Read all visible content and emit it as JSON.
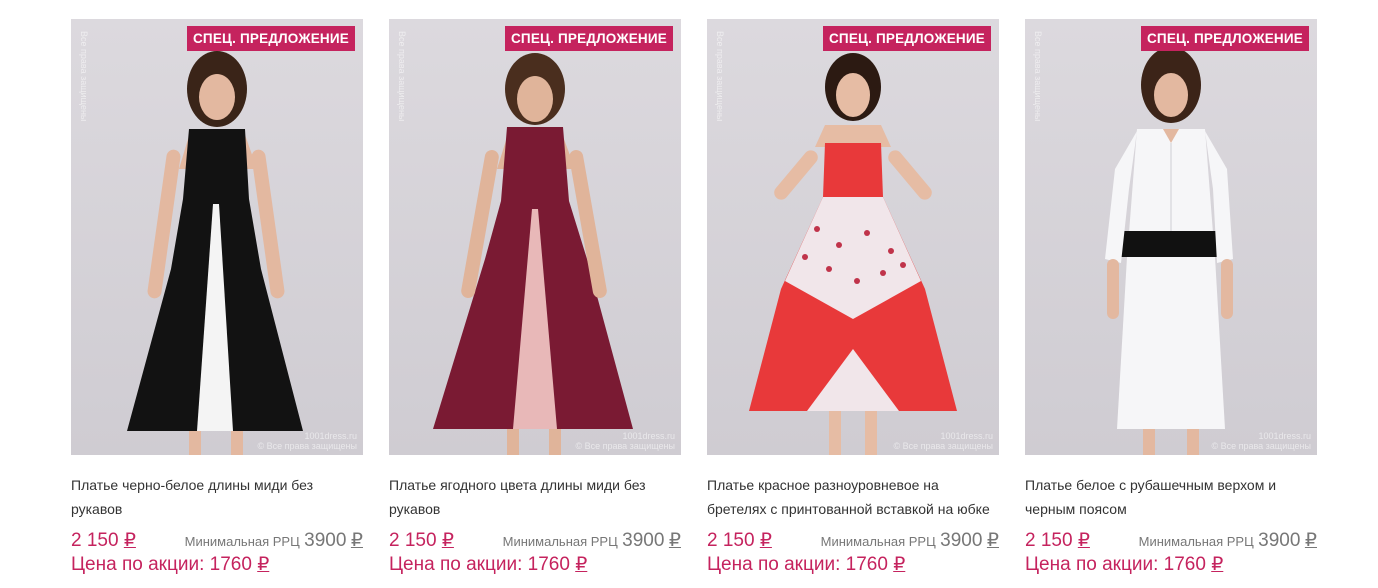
{
  "watermark": {
    "side": "Все права защищены",
    "site": "1001dress.ru",
    "bottom_line1": "1001dress.ru",
    "bottom_line2": "© Все права защищены"
  },
  "colors": {
    "accent": "#c5235e",
    "muted": "#777777"
  },
  "products": [
    {
      "badge": "Спец. предложение",
      "name": "Платье черно-белое длины миди без рукавов",
      "price": "2 150",
      "currency": "₽",
      "rrp_label": "Минимальная РРЦ",
      "rrp_value": "3900",
      "promo": "Цена по акции: 1760",
      "dress": "black-white"
    },
    {
      "badge": "Спец. предложение",
      "name": "Платье ягодного цвета длины миди без рукавов",
      "price": "2 150",
      "currency": "₽",
      "rrp_label": "Минимальная РРЦ",
      "rrp_value": "3900",
      "promo": "Цена по акции: 1760",
      "dress": "berry"
    },
    {
      "badge": "Спец. предложение",
      "name": "Платье красное разноуровневое на бретелях с принтованной вставкой на юбке",
      "price": "2 150",
      "currency": "₽",
      "rrp_label": "Минимальная РРЦ",
      "rrp_value": "3900",
      "promo": "Цена по акции: 1760",
      "dress": "red-print"
    },
    {
      "badge": "Спец. предложение",
      "name": "Платье белое с рубашечным верхом и черным поясом",
      "price": "2 150",
      "currency": "₽",
      "rrp_label": "Минимальная РРЦ",
      "rrp_value": "3900",
      "promo": "Цена по акции: 1760",
      "dress": "white-shirt"
    }
  ]
}
